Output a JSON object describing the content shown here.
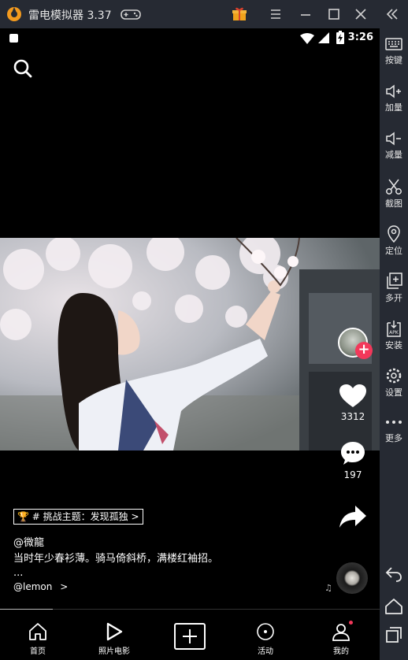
{
  "emulator": {
    "title": "雷电模拟器 3.37",
    "sidebar": [
      {
        "icon": "keyboard-icon",
        "label": "按键"
      },
      {
        "icon": "volume-up-icon",
        "label": "加量"
      },
      {
        "icon": "volume-down-icon",
        "label": "减量"
      },
      {
        "icon": "scissors-icon",
        "label": "截图"
      },
      {
        "icon": "location-pin-icon",
        "label": "定位"
      },
      {
        "icon": "multi-instance-icon",
        "label": "多开"
      },
      {
        "icon": "apk-install-icon",
        "label": "安装"
      },
      {
        "icon": "gear-icon",
        "label": "设置"
      },
      {
        "icon": "more-dots-icon",
        "label": "更多"
      }
    ]
  },
  "status_bar": {
    "time": "3:26"
  },
  "video": {
    "likes": "3312",
    "comments": "197",
    "topic": "# 挑战主题：发现孤独",
    "author": "@微龍",
    "caption": "当时年少春衫薄。骑马倚斜桥，满楼红袖招。",
    "more": "...",
    "music": "@lemon",
    "progress": 0.14
  },
  "bottom_nav": {
    "home": "首页",
    "photo_movie": "照片电影",
    "activity": "活动",
    "mine": "我的"
  },
  "colors": {
    "accent": "#f2385a",
    "emulator_bg": "#262a33"
  }
}
